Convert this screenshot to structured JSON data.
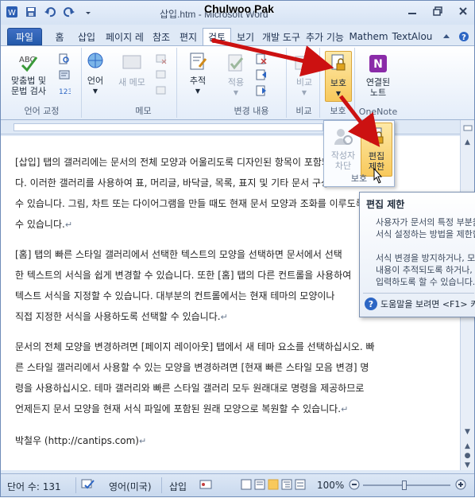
{
  "window": {
    "title": "삽입.htm - Microsoft Word",
    "overlay_author": "Chulwoo Pak"
  },
  "tabs": [
    {
      "label": "파일"
    },
    {
      "label": "홈"
    },
    {
      "label": "삽입"
    },
    {
      "label": "페이지 레"
    },
    {
      "label": "참조"
    },
    {
      "label": "편지"
    },
    {
      "label": "검토"
    },
    {
      "label": "보기"
    },
    {
      "label": "개발 도구"
    },
    {
      "label": "추가 기능"
    },
    {
      "label": "Mathem"
    },
    {
      "label": "TextAlou"
    }
  ],
  "ribbon": {
    "groups": {
      "proofing": "언어 교정",
      "memo": "메모",
      "changes": "변경 내용",
      "compare": "비교",
      "protect": "보호",
      "onenote": "OneNote"
    },
    "buttons": {
      "spelling": "맞춤법 및\n문법 검사",
      "language": "언어",
      "new_memo": "새 메모",
      "track": "추적",
      "accept": "적용",
      "compare": "비교",
      "protect": "보호",
      "linked_notes": "연결된\n노트"
    }
  },
  "dropdown": {
    "block_authors": "작성자\n차단",
    "restrict_editing": "편집\n제한",
    "label": "보호"
  },
  "tooltip": {
    "title": "편집 제한",
    "body1": [
      "사용자가 문서의 특정 부분을",
      "서식 설정하는 방법을 제한합니다."
    ],
    "body2": [
      "서식 변경을 방지하거나, 모든",
      "내용이 추적되도록 하거나, 메모만",
      "입력하도록 할 수 있습니다."
    ],
    "help": "도움말을 보려면 <F1> 키를"
  },
  "document": {
    "paragraphs": [
      [
        "[삽입] 탭의 갤러리에는 문서의 전체 모양과 어울리도록 디자인된 항목이 포함되어 있습니",
        "다. 이러한 갤러리를 사용하여 표, 머리글, 바닥글, 목록, 표지 및 기타 문서 구성 요소를 삽입할",
        "수 있습니다. 그림, 차트 또는 다이어그램을 만들 때도 현재 문서 모양과 조화를 이루도록 할",
        "수 있습니다."
      ],
      [
        "[홈] 탭의 빠른 스타일 갤러리에서 선택한 텍스트의 모양을 선택하면 문서에서 선택",
        "한 텍스트의 서식을 쉽게 변경할 수 있습니다. 또한 [홈] 탭의 다른 컨트롤을 사용하여",
        "텍스트 서식을 지정할 수 있습니다. 대부분의 컨트롤에서는 현재 테마의 모양이나",
        "직접 지정한 서식을 사용하도록 선택할 수 있습니다."
      ],
      [
        "문서의 전체 모양을 변경하려면 [페이지 레이아웃] 탭에서 새 테마 요소를 선택하십시오. 빠",
        "른 스타일 갤러리에서 사용할 수 있는 모양을 변경하려면 [현재 빠른 스타일 모음 변경] 명",
        "령을 사용하십시오. 테마 갤러리와 빠른 스타일 갤러리 모두 원래대로 명령을 제공하므로",
        "언제든지 문서 모양을 현재 서식 파일에 포함된 원래 모양으로 복원할 수 있습니다."
      ],
      [
        "박철우 (http://cantips.com)"
      ]
    ]
  },
  "statusbar": {
    "word_count": "단어 수: 131",
    "language": "영어(미국)",
    "mode": "삽입",
    "zoom": "100%"
  },
  "colors": {
    "accent": "#2d66c4",
    "arrow": "#cc1111"
  }
}
